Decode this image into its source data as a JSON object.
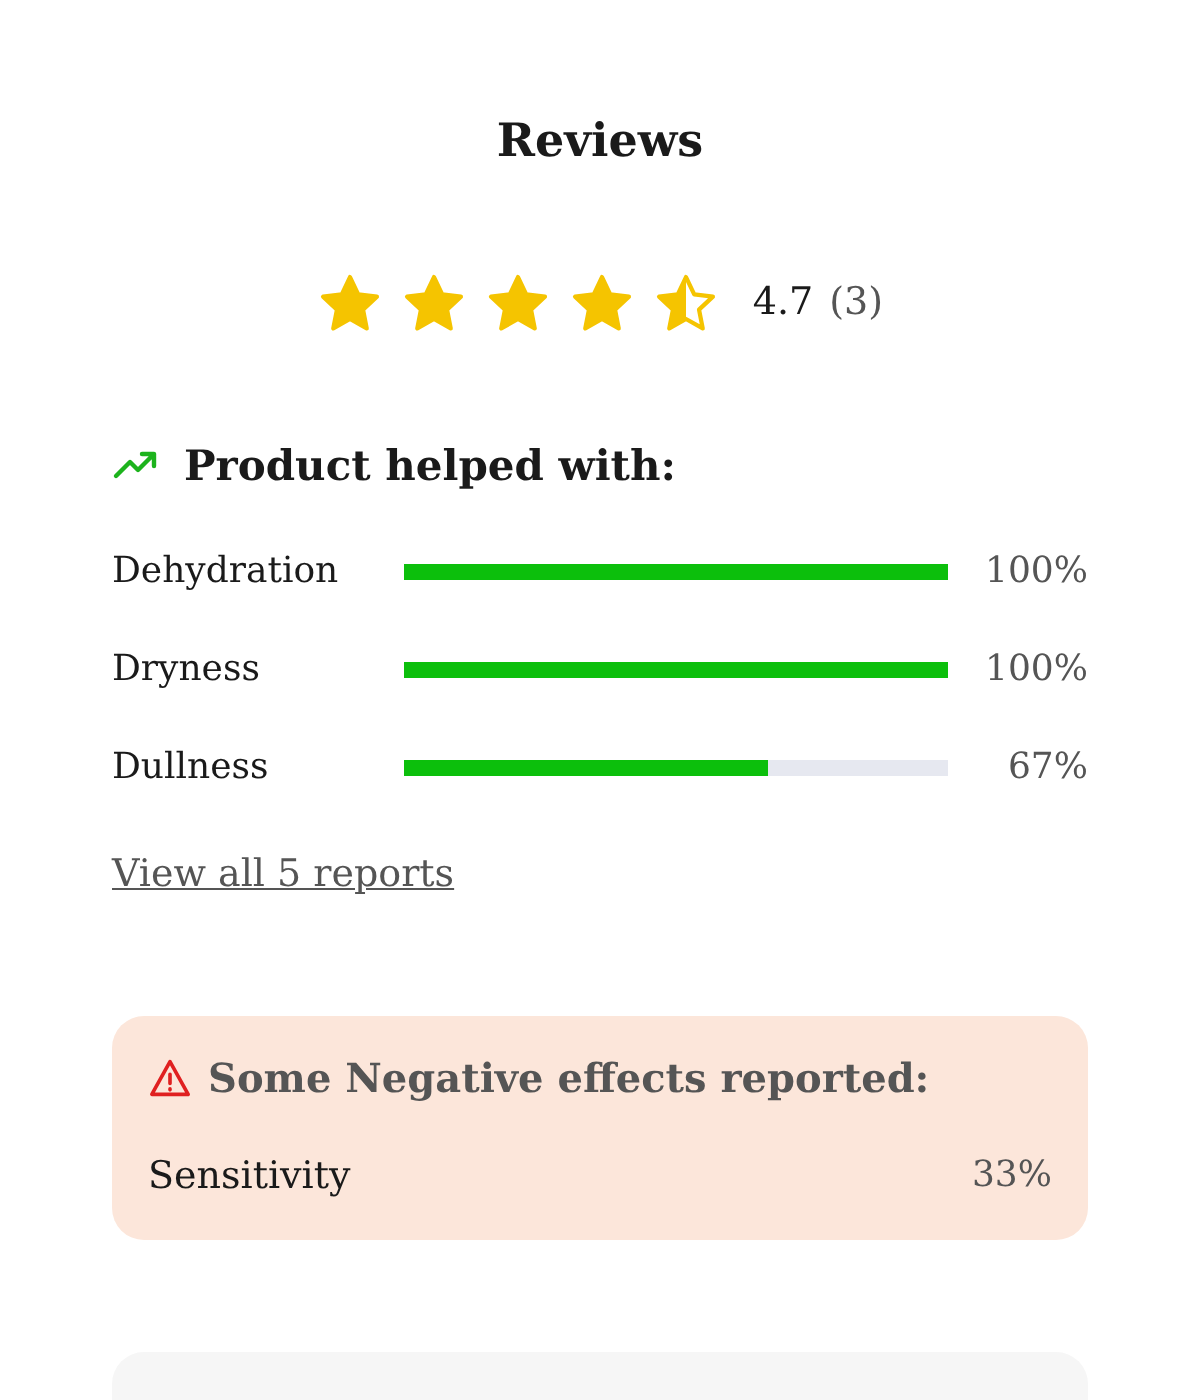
{
  "title": "Reviews",
  "rating": {
    "stars": 4.5,
    "score": "4.7",
    "count": "(3)"
  },
  "helped": {
    "heading": "Product helped with:",
    "items": [
      {
        "label": "Dehydration",
        "level": 1,
        "reading": "100%"
      },
      {
        "label": "Dryness",
        "level": 1,
        "reading": "100%"
      },
      {
        "label": "Dullness",
        "level": 0.67,
        "reading": "67%"
      }
    ]
  },
  "link": "View all 5 reports",
  "negative": {
    "heading": "Some Negative effects reported:",
    "items": [
      {
        "label": "Sensitivity",
        "reading": "33%"
      }
    ]
  }
}
